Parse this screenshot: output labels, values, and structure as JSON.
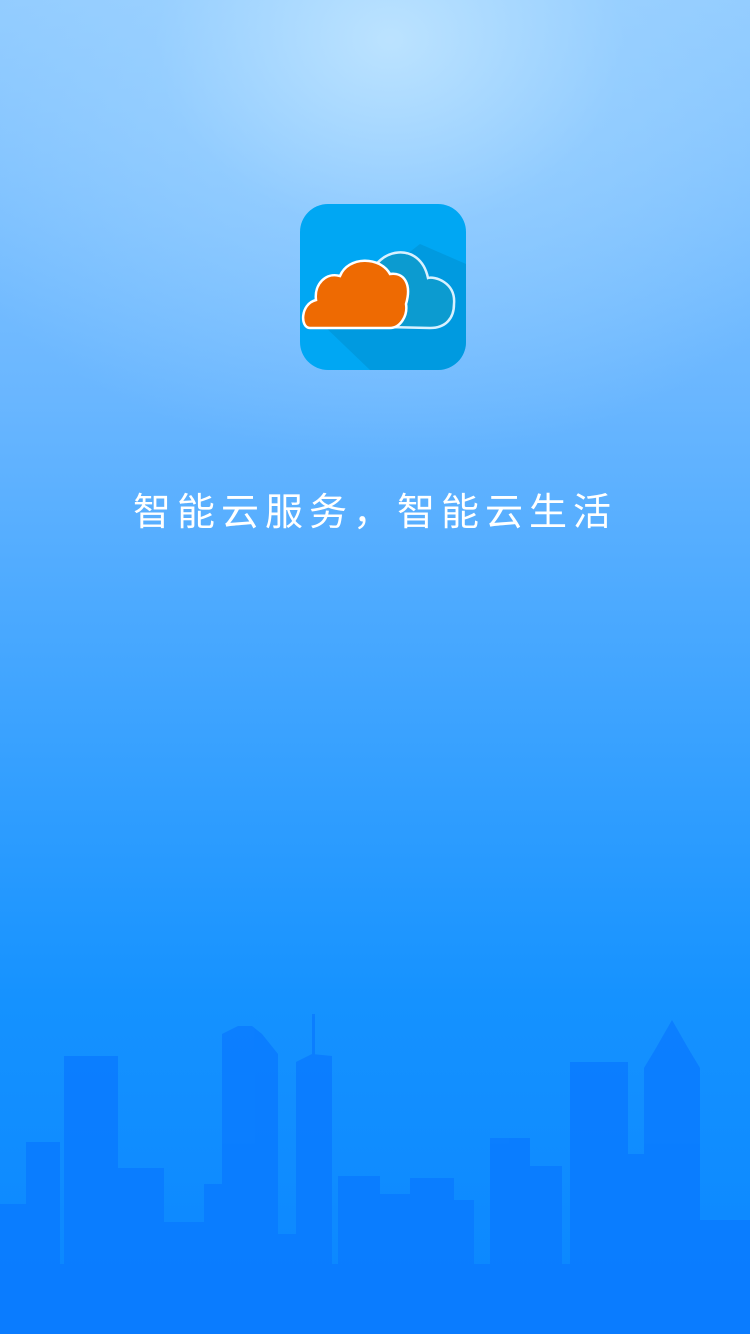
{
  "splash": {
    "tagline": "智能云服务，智能云生活",
    "logo_icon": "cloud-app-icon",
    "skyline_icon": "city-skyline",
    "colors": {
      "icon_background": "#00a7f3",
      "cloud_orange": "#ee6a02",
      "cloud_blue": "#0c9bd0",
      "skyline": "#0a7bff"
    }
  }
}
